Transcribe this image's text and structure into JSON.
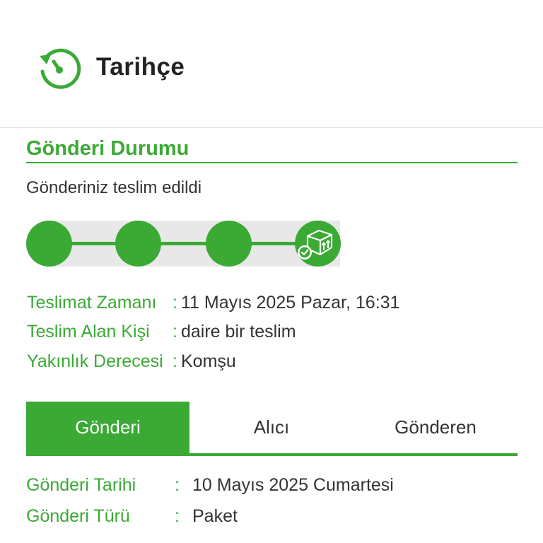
{
  "header": {
    "title": "Tarihçe",
    "icon": "history-icon"
  },
  "status": {
    "section_title": "Gönderi Durumu",
    "message": "Gönderiniz teslim edildi",
    "steps_completed": 4,
    "steps_total": 4,
    "accent_color": "#3aaa35"
  },
  "delivery_info": [
    {
      "label": "Teslimat Zamanı",
      "separator": ":",
      "value": "11 Mayıs 2025 Pazar, 16:31"
    },
    {
      "label": "Teslim Alan Kişi",
      "separator": ":",
      "value": "daire bir teslim"
    },
    {
      "label": "Yakınlık Derecesi",
      "separator": ":",
      "value": "Komşu"
    }
  ],
  "tabs": [
    {
      "label": "Gönderi",
      "active": true
    },
    {
      "label": "Alıcı",
      "active": false
    },
    {
      "label": "Gönderen",
      "active": false
    }
  ],
  "shipment_details": [
    {
      "label": "Gönderi Tarihi",
      "separator": ":",
      "value": "10 Mayıs 2025 Cumartesi"
    },
    {
      "label": "Gönderi Türü",
      "separator": ":",
      "value": "Paket"
    }
  ]
}
